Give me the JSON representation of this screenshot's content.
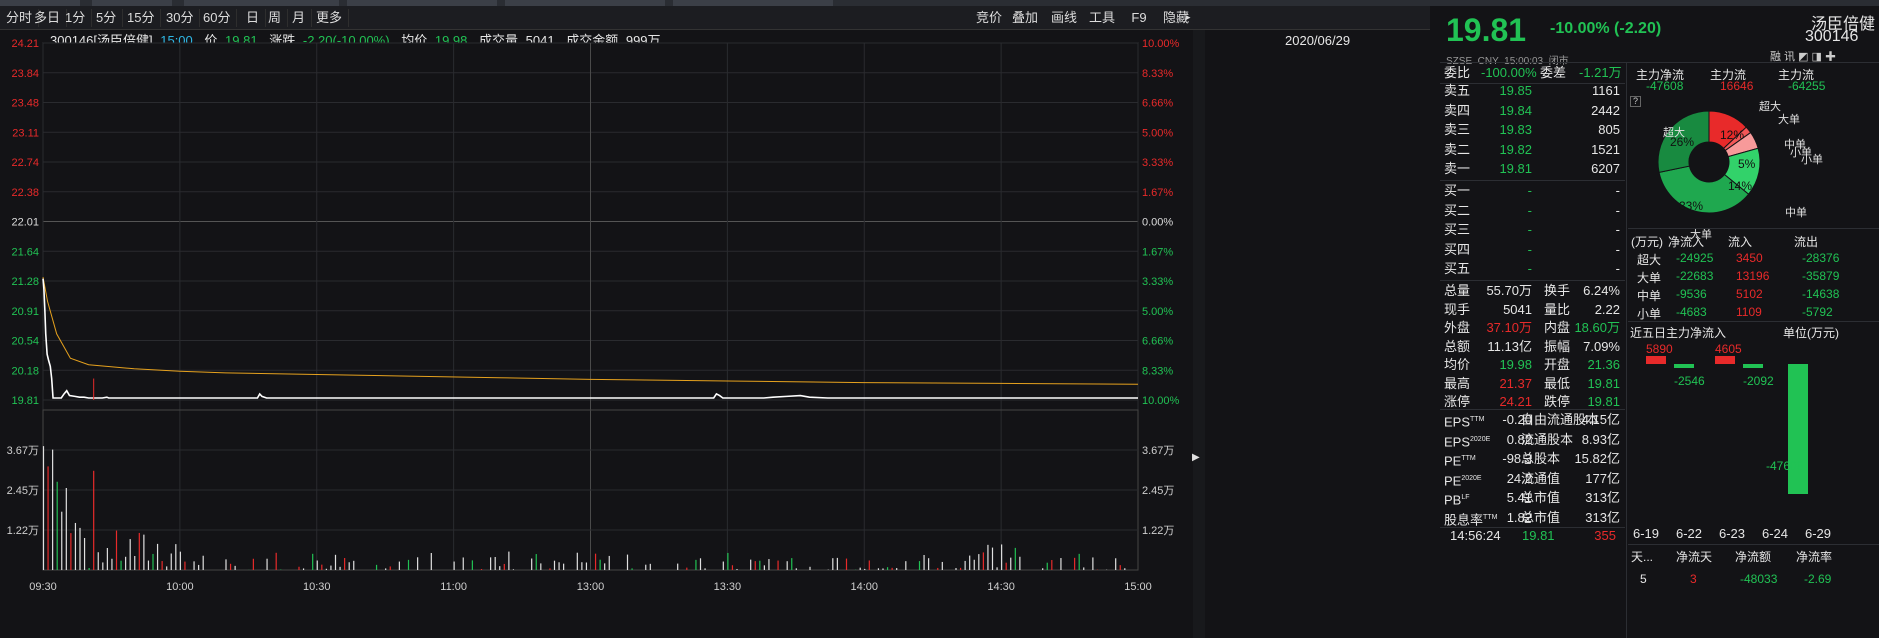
{
  "periods": [
    "分时",
    "多日",
    "1分",
    "5分",
    "15分",
    "30分",
    "60分",
    "日",
    "周",
    "月",
    "更多"
  ],
  "rtools": [
    "竞价",
    "叠加",
    "画线",
    "工具",
    "F9",
    "隐藏"
  ],
  "info": {
    "code_name": "300146[汤臣倍健]",
    "time": "15:00",
    "price_label": "价",
    "price": "19.81",
    "change_label": "涨跌",
    "change": "-2.20(-10.00%)",
    "avg_label": "均价",
    "avg": "19.98",
    "vol_label": "成交量",
    "vol": "5041",
    "amount_label": "成交金额",
    "amount": "999万",
    "date": "2020/06/29"
  },
  "chart_data": {
    "type": "line",
    "y_left": [
      "24.21",
      "23.84",
      "23.48",
      "23.11",
      "22.74",
      "22.38",
      "22.01",
      "21.64",
      "21.28",
      "20.91",
      "20.54",
      "20.18",
      "19.81"
    ],
    "y_right": [
      "10.00%",
      "8.33%",
      "6.66%",
      "5.00%",
      "3.33%",
      "1.67%",
      "0.00%",
      "1.67%",
      "3.33%",
      "5.00%",
      "6.66%",
      "8.33%",
      "10.00%"
    ],
    "vol_labels": [
      "3.67万",
      "2.45万",
      "1.22万"
    ],
    "x_labels": [
      "09:30",
      "10:00",
      "10:30",
      "11:00",
      "13:00",
      "13:30",
      "14:00",
      "14:30",
      "15:00"
    ],
    "ylim": [
      19.81,
      24.21
    ],
    "price_points": [
      [
        0,
        21.28
      ],
      [
        0.2,
        21.15
      ],
      [
        0.4,
        20.9
      ],
      [
        0.6,
        20.6
      ],
      [
        0.9,
        20.35
      ],
      [
        1.2,
        20.28
      ],
      [
        1.6,
        20.2
      ],
      [
        1.9,
        20.05
      ],
      [
        2.2,
        19.81
      ],
      [
        3,
        19.81
      ],
      [
        4,
        19.81
      ],
      [
        4.6,
        19.86
      ],
      [
        5.2,
        19.9
      ],
      [
        5.8,
        19.84
      ],
      [
        7,
        19.83
      ],
      [
        8,
        19.82
      ],
      [
        9,
        19.82
      ],
      [
        10,
        19.81
      ],
      [
        12,
        19.81
      ],
      [
        13,
        19.81
      ],
      [
        14,
        19.82
      ],
      [
        14.4,
        19.81
      ],
      [
        20,
        19.81
      ],
      [
        30,
        19.81
      ],
      [
        40,
        19.81
      ],
      [
        47,
        19.81
      ],
      [
        47.5,
        19.86
      ],
      [
        48,
        19.83
      ],
      [
        49,
        19.81
      ],
      [
        60,
        19.81
      ],
      [
        70,
        19.81
      ],
      [
        80,
        19.81
      ],
      [
        90,
        19.81
      ],
      [
        100,
        19.81
      ],
      [
        110,
        19.81
      ],
      [
        120,
        19.81
      ],
      [
        130,
        19.81
      ],
      [
        140,
        19.81
      ],
      [
        147,
        19.81
      ],
      [
        147.6,
        19.86
      ],
      [
        148.3,
        19.84
      ],
      [
        149,
        19.81
      ],
      [
        158,
        19.81
      ],
      [
        160,
        19.82
      ],
      [
        163,
        19.83
      ],
      [
        166,
        19.84
      ],
      [
        168,
        19.82
      ],
      [
        172,
        19.81
      ],
      [
        180,
        19.81
      ],
      [
        200,
        19.81
      ],
      [
        220,
        19.81
      ],
      [
        240,
        19.81
      ]
    ],
    "avg_points": [
      [
        0,
        21.3
      ],
      [
        1,
        21.0
      ],
      [
        3,
        20.6
      ],
      [
        6,
        20.3
      ],
      [
        10,
        20.22
      ],
      [
        20,
        20.17
      ],
      [
        30,
        20.14
      ],
      [
        40,
        20.12
      ],
      [
        60,
        20.1
      ],
      [
        80,
        20.08
      ],
      [
        100,
        20.06
      ],
      [
        120,
        20.04
      ],
      [
        150,
        20.02
      ],
      [
        180,
        20.0
      ],
      [
        210,
        19.99
      ],
      [
        240,
        19.98
      ]
    ]
  },
  "quote": {
    "price": "19.81",
    "change": "-10.00% (-2.20)",
    "name": "汤臣倍健",
    "code": "300146",
    "meta": "SZSE  CNY  15:00:03  闭市"
  },
  "weibi": {
    "label1": "委比",
    "v1": "-100.00%",
    "label2": "委差",
    "v2": "-1.21万"
  },
  "asks": [
    {
      "l": "卖五",
      "p": "19.85",
      "v": "1161"
    },
    {
      "l": "卖四",
      "p": "19.84",
      "v": "2442"
    },
    {
      "l": "卖三",
      "p": "19.83",
      "v": "805"
    },
    {
      "l": "卖二",
      "p": "19.82",
      "v": "1521"
    },
    {
      "l": "卖一",
      "p": "19.81",
      "v": "6207"
    }
  ],
  "bids": [
    {
      "l": "买一",
      "p": "-",
      "v": "-"
    },
    {
      "l": "买二",
      "p": "-",
      "v": "-"
    },
    {
      "l": "买三",
      "p": "-",
      "v": "-"
    },
    {
      "l": "买四",
      "p": "-",
      "v": "-"
    },
    {
      "l": "买五",
      "p": "-",
      "v": "-"
    }
  ],
  "stats": [
    {
      "a": "总量",
      "av": "55.70万",
      "b": "换手",
      "bv": "6.24%"
    },
    {
      "a": "现手",
      "av": "5041",
      "b": "量比",
      "bv": "2.22"
    },
    {
      "a": "外盘",
      "av": "37.10万",
      "b": "内盘",
      "bv": "18.60万"
    },
    {
      "a": "总额",
      "av": "11.13亿",
      "b": "振幅",
      "bv": "7.09%"
    },
    {
      "a": "均价",
      "av": "19.98",
      "b": "开盘",
      "bv": "21.36"
    },
    {
      "a": "最高",
      "av": "21.37",
      "b": "最低",
      "bv": "19.81"
    },
    {
      "a": "涨停",
      "av": "24.21",
      "b": "跌停",
      "bv": "19.81"
    }
  ],
  "fin": [
    {
      "a": "EPS",
      "sup": "TTM",
      "av": "-0.20",
      "b": "自由流通股本",
      "bv": "4.15亿"
    },
    {
      "a": "EPS",
      "sup": "2020E",
      "av": "0.82",
      "b": "流通股本",
      "bv": "8.93亿"
    },
    {
      "a": "PE",
      "sup": "TTM",
      "av": "-98.3",
      "b": "总股本",
      "bv": "15.82亿"
    },
    {
      "a": "PE",
      "sup": "2020E",
      "av": "24.2",
      "b": "流通值",
      "bv": "177亿"
    },
    {
      "a": "PB",
      "sup": "LF",
      "av": "5.41",
      "b": "总市值",
      "bv": "313亿"
    },
    {
      "a": "股息率",
      "sup": "TTM",
      "av": "1.82",
      "b": "总市值",
      "bv": "313亿"
    }
  ],
  "lastrow": {
    "t": "14:56:24",
    "p": "19.81",
    "v": "355"
  },
  "flow": {
    "h1": "主力净流",
    "v1": "-47608",
    "h2": "主力流",
    "v2": "16646",
    "h3": "主力流",
    "v3": "-64255"
  },
  "pie": {
    "labels": [
      "超大",
      "大单",
      "中单",
      "小单",
      "超大",
      "中单",
      "小单",
      "大单"
    ],
    "pcts": [
      "12%",
      "5%",
      "14%",
      "33%",
      "26%"
    ],
    "values": [
      12,
      2,
      5,
      14,
      33,
      26
    ]
  },
  "flowtable": {
    "headers": [
      "(万元)",
      "净流入",
      "流入",
      "流出"
    ],
    "rows": [
      [
        "超大",
        "-24925",
        "3450",
        "-28376"
      ],
      [
        "大单",
        "-22683",
        "13196",
        "-35879"
      ],
      [
        "中单",
        "-9536",
        "5102",
        "-14638"
      ],
      [
        "小单",
        "-4683",
        "1109",
        "-5792"
      ]
    ]
  },
  "five": {
    "title": "近五日主力净流入",
    "unit": "单位(万元)",
    "values": [
      5890,
      -2546,
      4605,
      -2092,
      -47608
    ],
    "labels": [
      "5890",
      "-2546",
      "4605",
      "-2092",
      "-47608"
    ],
    "dates": [
      "6-19",
      "6-22",
      "6-23",
      "6-24",
      "6-29"
    ]
  },
  "btm": {
    "headers": [
      "天...",
      "净流天",
      "净流额",
      "净流率"
    ],
    "row": [
      "5",
      "3",
      "-48033",
      "-2.69"
    ]
  }
}
